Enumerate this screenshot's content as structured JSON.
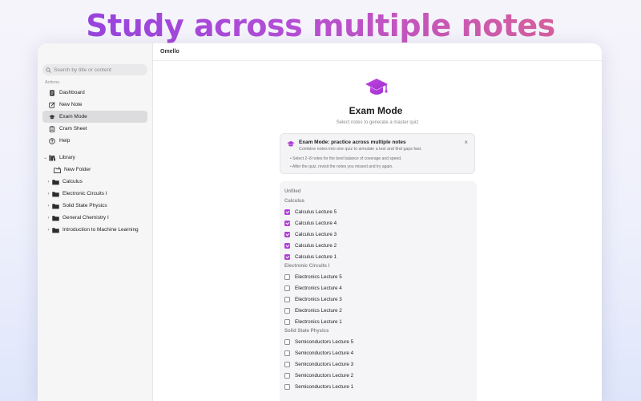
{
  "headline": "Study across multiple notes",
  "app": {
    "title": "Omello",
    "accent": "#b03fd6"
  },
  "sidebar": {
    "search_placeholder": "Search by title or content",
    "actions_label": "Actions",
    "actions": [
      {
        "label": "Dashboard",
        "icon": "document-icon"
      },
      {
        "label": "New Note",
        "icon": "new-note-icon"
      },
      {
        "label": "Exam Mode",
        "icon": "graduation-cap-icon",
        "active": true
      },
      {
        "label": "Cram Sheet",
        "icon": "clipboard-icon"
      },
      {
        "label": "Help",
        "icon": "help-circle-icon"
      }
    ],
    "library": {
      "label": "Library",
      "new_folder": "New Folder",
      "folders": [
        "Calculus",
        "Electronic Circuits I",
        "Solid State Physics",
        "General Chemistry I",
        "Introduction to Machine Learning"
      ]
    }
  },
  "exam": {
    "title": "Exam Mode",
    "subtitle": "Select notes to generate a master quiz",
    "info": {
      "title": "Exam Mode: practice across multiple notes",
      "subtitle": "Combine notes into one quiz to simulate a test and find gaps fast.",
      "bullet1": "•  Select 2–8 notes for the best balance of coverage and speed.",
      "bullet2": "•  After the quiz, revisit the notes you missed and try again.",
      "close": "×"
    }
  },
  "notes": {
    "unfiled_label": "Unfiled",
    "groups": [
      {
        "name": "Calculus",
        "items": [
          {
            "label": "Calculus Lecture 5",
            "checked": true
          },
          {
            "label": "Calculus Lecture 4",
            "checked": true
          },
          {
            "label": "Calculus Lecture 3",
            "checked": true
          },
          {
            "label": "Calculus Lecture 2",
            "checked": true
          },
          {
            "label": "Calculus Lecture 1",
            "checked": true
          }
        ]
      },
      {
        "name": "Electronic Circuits I",
        "items": [
          {
            "label": "Electronics Lecture 5",
            "checked": false
          },
          {
            "label": "Electronics Lecture 4",
            "checked": false
          },
          {
            "label": "Electronics Lecture 3",
            "checked": false
          },
          {
            "label": "Electronics Lecture 2",
            "checked": false
          },
          {
            "label": "Electronics Lecture 1",
            "checked": false
          }
        ]
      },
      {
        "name": "Solid State Physics",
        "items": [
          {
            "label": "Semiconductors Lecture 5",
            "checked": false
          },
          {
            "label": "Semiconductors Lecture 4",
            "checked": false
          },
          {
            "label": "Semiconductors Lecture 3",
            "checked": false
          },
          {
            "label": "Semiconductors Lecture 2",
            "checked": false
          },
          {
            "label": "Semiconductors Lecture 1",
            "checked": false
          }
        ]
      }
    ]
  }
}
